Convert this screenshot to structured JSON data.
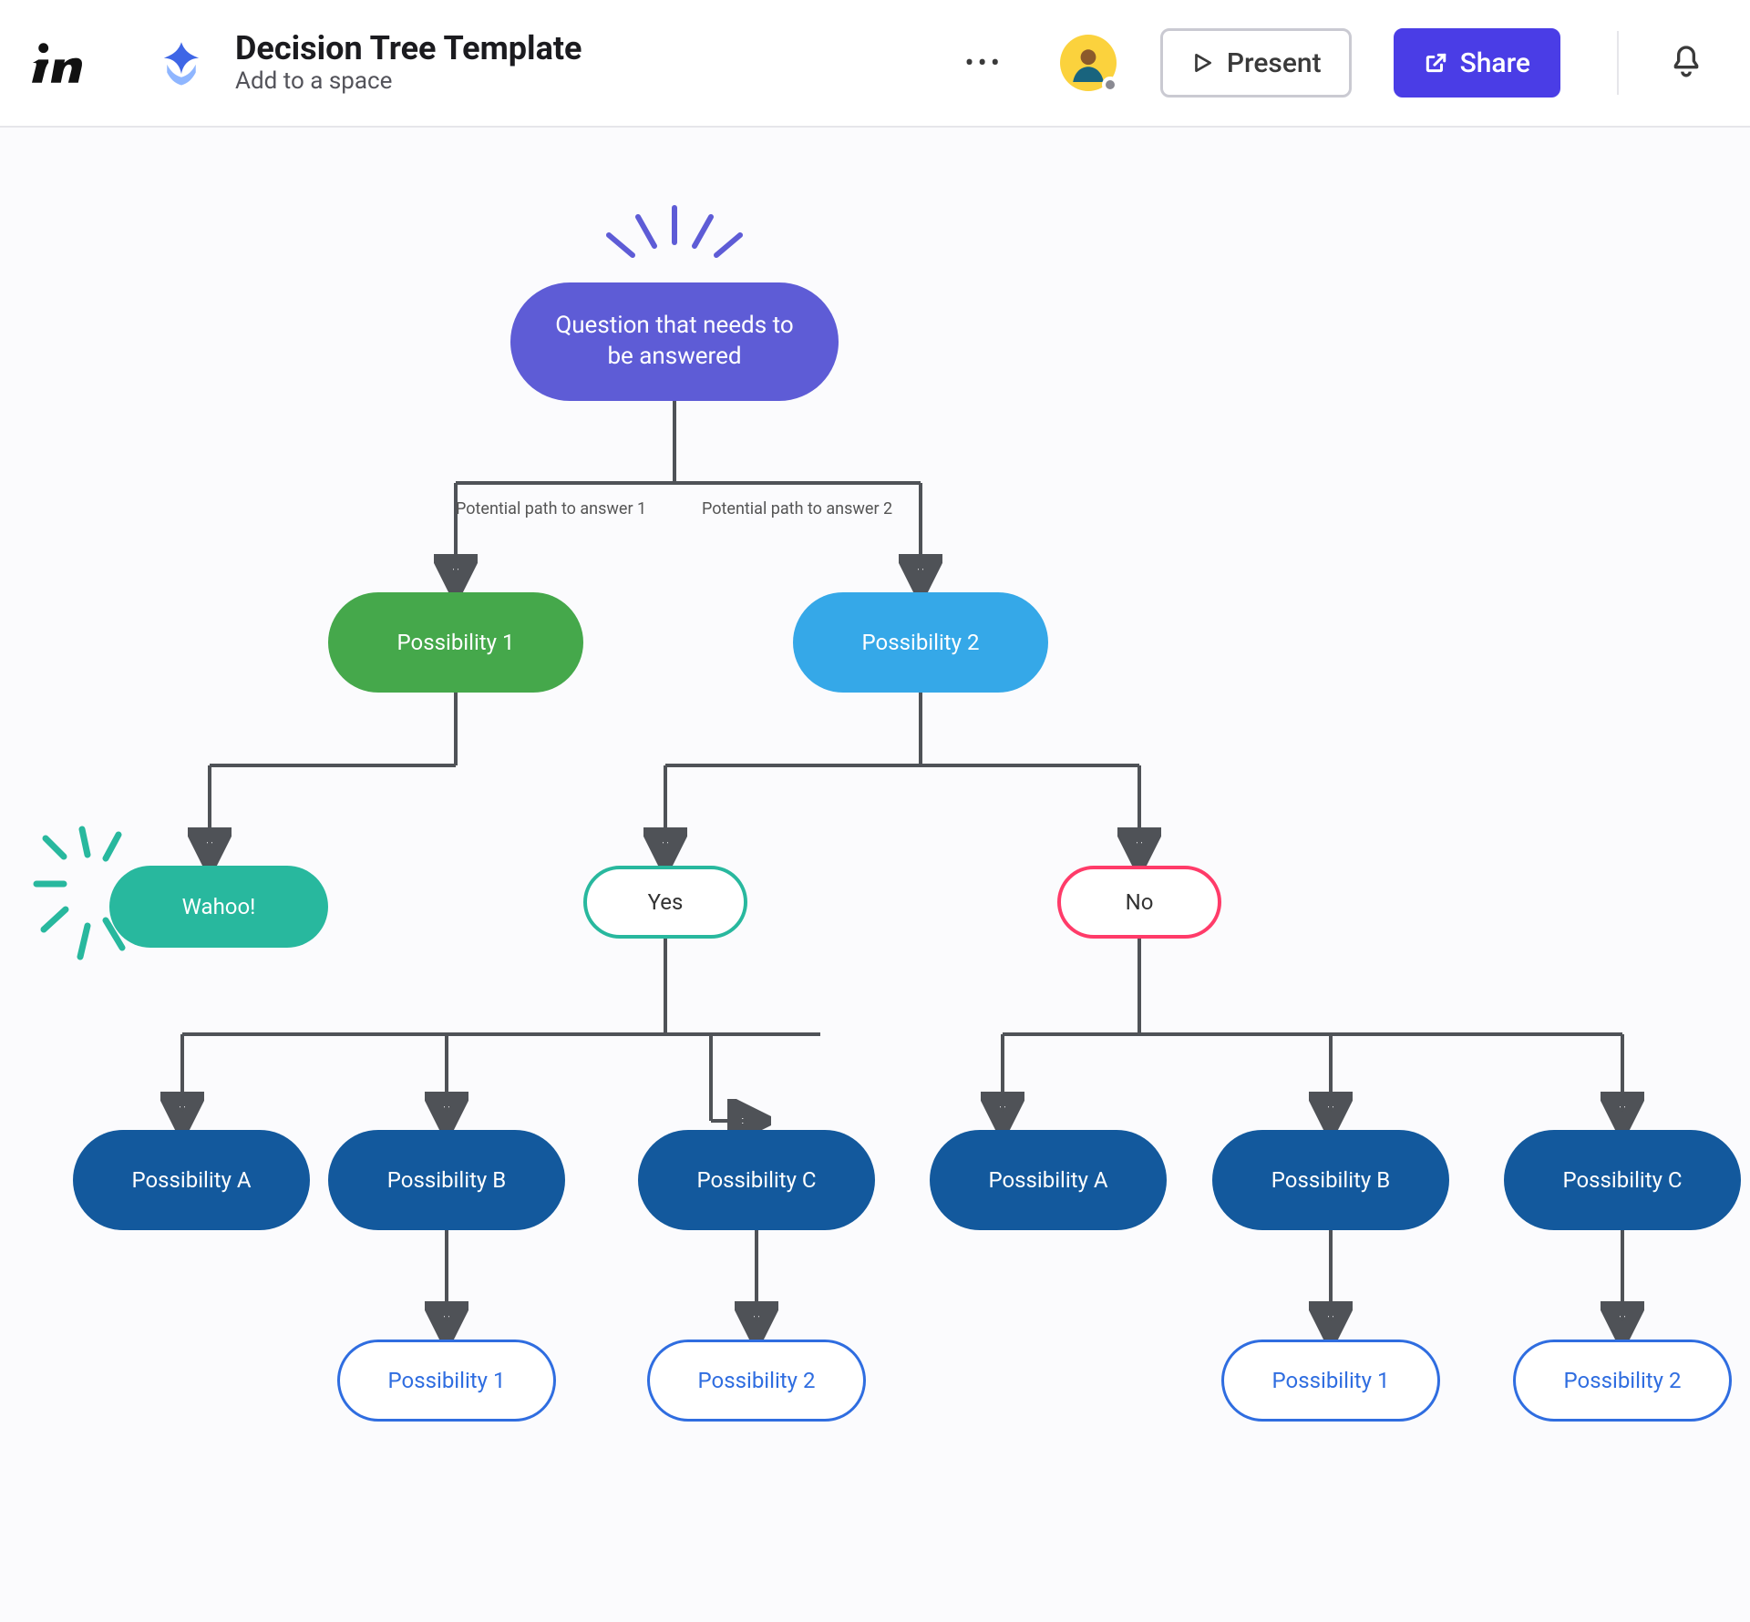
{
  "header": {
    "title": "Decision Tree Template",
    "subtitle": "Add to a space",
    "present_label": "Present",
    "share_label": "Share"
  },
  "colors": {
    "root": "#5E5CD6",
    "green": "#45A84B",
    "skyblue": "#35A8E8",
    "teal": "#28B89E",
    "navy": "#13599D",
    "pink": "#FF3B69",
    "blue_outline": "#2F6DE0"
  },
  "tree": {
    "root": "Question that needs to be answered",
    "edge_labels": {
      "left": "Potential path to answer 1",
      "right": "Potential path to answer 2"
    },
    "level2": {
      "left": "Possibility 1",
      "right": "Possibility 2"
    },
    "wahoo": "Wahoo!",
    "yesno": {
      "yes": "Yes",
      "no": "No"
    },
    "leaves": {
      "A": "Possibility A",
      "B": "Possibility B",
      "C": "Possibility C"
    },
    "final": {
      "P1": "Possibility 1",
      "P2": "Possibility 2"
    }
  },
  "chart_data": {
    "type": "tree",
    "title": "Decision Tree Template",
    "nodes": [
      {
        "id": "root",
        "label": "Question that needs to be answered",
        "color": "#5E5CD6",
        "shape": "pill-filled"
      },
      {
        "id": "poss1",
        "label": "Possibility 1",
        "color": "#45A84B",
        "shape": "pill-filled"
      },
      {
        "id": "poss2",
        "label": "Possibility 2",
        "color": "#35A8E8",
        "shape": "pill-filled"
      },
      {
        "id": "wahoo",
        "label": "Wahoo!",
        "color": "#28B89E",
        "shape": "pill-filled",
        "decoration": "burst"
      },
      {
        "id": "yes",
        "label": "Yes",
        "color": "#28B89E",
        "shape": "pill-outline"
      },
      {
        "id": "no",
        "label": "No",
        "color": "#FF3B69",
        "shape": "pill-outline"
      },
      {
        "id": "yA",
        "label": "Possibility A",
        "color": "#13599D",
        "shape": "pill-filled"
      },
      {
        "id": "yB",
        "label": "Possibility B",
        "color": "#13599D",
        "shape": "pill-filled"
      },
      {
        "id": "yC",
        "label": "Possibility C",
        "color": "#13599D",
        "shape": "pill-filled"
      },
      {
        "id": "nA",
        "label": "Possibility A",
        "color": "#13599D",
        "shape": "pill-filled"
      },
      {
        "id": "nB",
        "label": "Possibility B",
        "color": "#13599D",
        "shape": "pill-filled"
      },
      {
        "id": "nC",
        "label": "Possibility C",
        "color": "#13599D",
        "shape": "pill-filled"
      },
      {
        "id": "yP1",
        "label": "Possibility 1",
        "color": "#2F6DE0",
        "shape": "pill-outline"
      },
      {
        "id": "yP2",
        "label": "Possibility 2",
        "color": "#2F6DE0",
        "shape": "pill-outline"
      },
      {
        "id": "nP1",
        "label": "Possibility 1",
        "color": "#2F6DE0",
        "shape": "pill-outline"
      },
      {
        "id": "nP2",
        "label": "Possibility 2",
        "color": "#2F6DE0",
        "shape": "pill-outline"
      }
    ],
    "edges": [
      {
        "from": "root",
        "to": "poss1",
        "label": "Potential path to answer 1"
      },
      {
        "from": "root",
        "to": "poss2",
        "label": "Potential path to answer 2"
      },
      {
        "from": "poss1",
        "to": "wahoo"
      },
      {
        "from": "poss2",
        "to": "yes"
      },
      {
        "from": "poss2",
        "to": "no"
      },
      {
        "from": "yes",
        "to": "yA"
      },
      {
        "from": "yes",
        "to": "yB"
      },
      {
        "from": "yes",
        "to": "yC"
      },
      {
        "from": "no",
        "to": "nA"
      },
      {
        "from": "no",
        "to": "nB"
      },
      {
        "from": "no",
        "to": "nC"
      },
      {
        "from": "yB",
        "to": "yP1"
      },
      {
        "from": "yC",
        "to": "yP2"
      },
      {
        "from": "nB",
        "to": "nP1"
      },
      {
        "from": "nC",
        "to": "nP2"
      }
    ]
  }
}
